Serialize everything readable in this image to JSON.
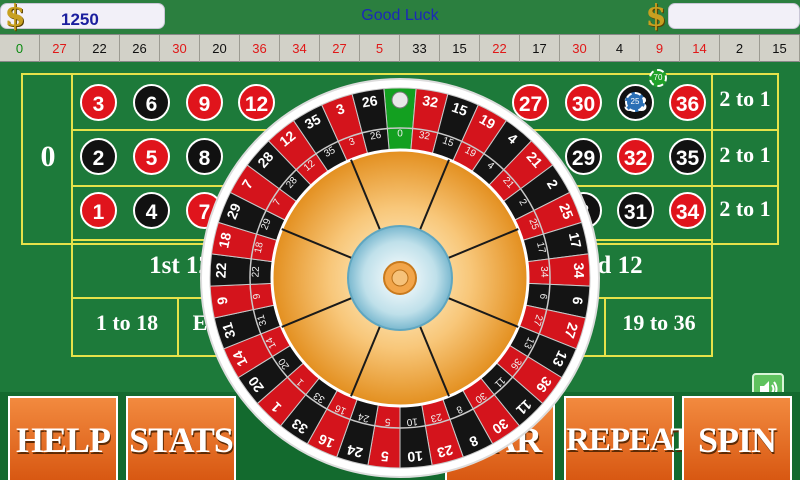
{
  "topbar": {
    "credit": "1250",
    "message": "Good Luck"
  },
  "history": [
    {
      "v": "0",
      "c": "green"
    },
    {
      "v": "27",
      "c": "red"
    },
    {
      "v": "22",
      "c": "black"
    },
    {
      "v": "26",
      "c": "black"
    },
    {
      "v": "30",
      "c": "red"
    },
    {
      "v": "20",
      "c": "black"
    },
    {
      "v": "36",
      "c": "red"
    },
    {
      "v": "34",
      "c": "red"
    },
    {
      "v": "27",
      "c": "red"
    },
    {
      "v": "5",
      "c": "red"
    },
    {
      "v": "33",
      "c": "black"
    },
    {
      "v": "15",
      "c": "black"
    },
    {
      "v": "22",
      "c": "red"
    },
    {
      "v": "17",
      "c": "black"
    },
    {
      "v": "30",
      "c": "red"
    },
    {
      "v": "4",
      "c": "black"
    },
    {
      "v": "9",
      "c": "red"
    },
    {
      "v": "14",
      "c": "red"
    },
    {
      "v": "2",
      "c": "black"
    },
    {
      "v": "15",
      "c": "black"
    }
  ],
  "table": {
    "zero": "0",
    "row_top": [
      {
        "v": "3",
        "c": "red"
      },
      {
        "v": "6",
        "c": "black"
      },
      {
        "v": "9",
        "c": "red"
      },
      {
        "v": "12",
        "c": "red"
      },
      {
        "v": "27",
        "c": "red"
      },
      {
        "v": "30",
        "c": "red"
      },
      {
        "v": "33",
        "c": "black"
      },
      {
        "v": "36",
        "c": "red"
      }
    ],
    "row_mid": [
      {
        "v": "2",
        "c": "black"
      },
      {
        "v": "5",
        "c": "red"
      },
      {
        "v": "8",
        "c": "black"
      },
      {
        "v": "29",
        "c": "black"
      },
      {
        "v": "32",
        "c": "red"
      },
      {
        "v": "35",
        "c": "black"
      }
    ],
    "row_bot": [
      {
        "v": "1",
        "c": "red"
      },
      {
        "v": "4",
        "c": "black"
      },
      {
        "v": "7",
        "c": "red"
      },
      {
        "v": "8",
        "c": "black"
      },
      {
        "v": "31",
        "c": "black"
      },
      {
        "v": "34",
        "c": "red"
      }
    ],
    "column_bets": [
      "2 to 1",
      "2 to 1",
      "2 to 1"
    ],
    "dozen_first": "1st 12",
    "dozen_third": "d 12",
    "low": "1 to 18",
    "even_partial": "E",
    "high": "19 to 36",
    "chips": [
      "70",
      "25"
    ]
  },
  "wheel": {
    "numbers": [
      "0",
      "32",
      "15",
      "19",
      "4",
      "21",
      "2",
      "25",
      "17",
      "34",
      "6",
      "27",
      "13",
      "36",
      "11",
      "30",
      "8",
      "23",
      "10",
      "5",
      "24",
      "16",
      "33",
      "1",
      "20",
      "14",
      "31",
      "9",
      "22",
      "18",
      "29",
      "7",
      "28",
      "12",
      "35",
      "3",
      "26"
    ],
    "reds": [
      "32",
      "19",
      "21",
      "25",
      "34",
      "27",
      "36",
      "30",
      "23",
      "5",
      "16",
      "1",
      "14",
      "9",
      "18",
      "7",
      "12",
      "3"
    ]
  },
  "buttons": {
    "help": "HELP",
    "stats": "STATS",
    "clear_partial": "AR",
    "repeat": "REPEAT",
    "spin": "SPIN"
  }
}
